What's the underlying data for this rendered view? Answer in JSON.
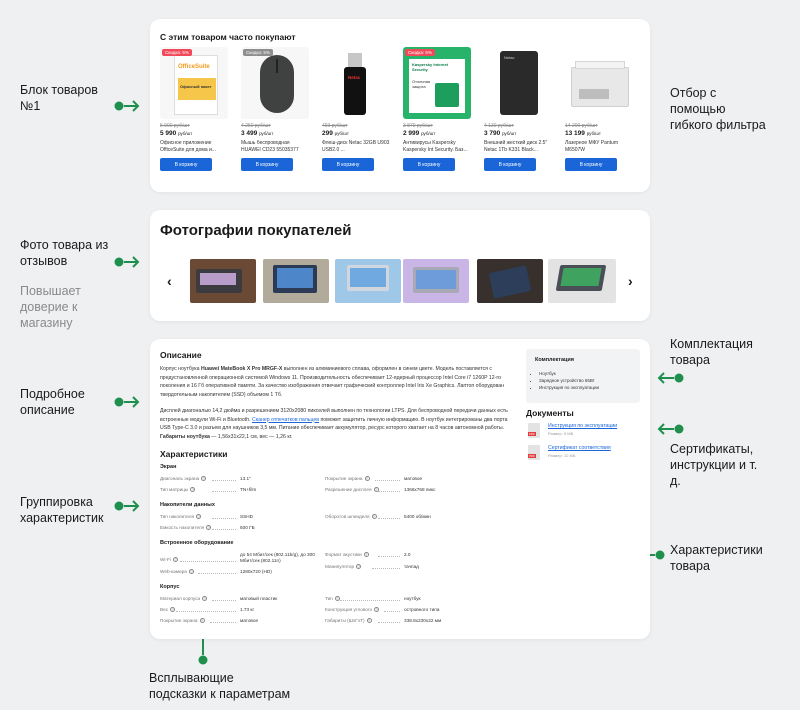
{
  "left_labels": {
    "block": "Блок товаров\n№1",
    "photos": "Фото товара из\nотзывов",
    "trust": "Повышает\nдоверие к\nмагазину",
    "desc": "Подробное\nописание",
    "group": "Группировка\nхарактеристик",
    "hints": "Всплывающие\nподсказки к параметрам"
  },
  "right_labels": {
    "filter": "Отбор с\nпомощью\nгибкого фильтра",
    "kit": "Комплектация\nтовара",
    "certs": "Сертификаты,\nинструкции и т.\nд.",
    "chars": "Характеристики\nтовара"
  },
  "related": {
    "title": "С этим товаром часто покупают",
    "products": [
      {
        "discount": "Скидка: 5%",
        "discount_style": "red",
        "old": "5 990 руб/шт",
        "price": "5 990",
        "unit": "руб/шт",
        "name": "Офисное приложение OfficeSuite для дома и...",
        "button": "В корзину"
      },
      {
        "discount": "Скидка: 5%",
        "discount_style": "grey",
        "old": "4 250 руб/шт",
        "price": "3 499",
        "unit": "руб/шт",
        "name": "Мышь беспроводная HUAWEI CD23 55035377",
        "button": "В корзину"
      },
      {
        "discount": "",
        "discount_style": "",
        "old": "469 руб/шт",
        "price": "299",
        "unit": "руб/шт",
        "name": "Флеш-диск Netac 32GB U903 USB2.0 ...",
        "button": "В корзину"
      },
      {
        "discount": "Скидка: 5%",
        "discount_style": "red",
        "old": "3 870 руб/шт",
        "price": "2 999",
        "unit": "руб/шт",
        "name": "Антивирусы Kaspersky Kaspersky Int Security. Баз...",
        "button": "В корзину"
      },
      {
        "discount": "",
        "discount_style": "",
        "old": "4 130 руб/шт",
        "price": "3 790",
        "unit": "руб/шт",
        "name": "Внешний жесткий диск 2.5\" Netac 1Tb K331 Black...",
        "button": "В корзину"
      },
      {
        "discount": "",
        "discount_style": "",
        "old": "14 200 руб/шт",
        "price": "13 199",
        "unit": "руб/шт",
        "name": "Лазерное МФУ Pantum M6507W",
        "button": "В корзину"
      }
    ],
    "product_art": {
      "officesuite": "OfficeSuite",
      "office_pack": "Офисный пакет",
      "kaspersky": "Kaspersky Internet Security",
      "kasp_box": "Отличная защита",
      "netac": "Netac"
    }
  },
  "photos": {
    "title": "Фотографии покупателей",
    "prev": "‹",
    "next": "›"
  },
  "description": {
    "title": "Описание",
    "p1_a": "Корпус ноутбука ",
    "p1_b": "Huawei MateBook X Pro MRGF-X",
    "p1_c": " выполнен из алюминиевого сплава, оформлен в синем цвете. Модель поставляется с предустановленной операционной системой Windows 11. Производительность обеспечивает 12-ядерный процессор Intel Core i7 1260P 12-го поколения и 16 Гб оперативной памяти. За качество изображения отвечает графический контроллер Intel Iris Xe Graphics. Лаптоп оборудован твердотельным накопителем (SSD) объемом 1 Тб.",
    "p2_a": "Дисплей диагональю 14,2 дюйма и разрешением 3120х2080 пикселей выполнен по технологии LTPS. Для беспроводной передачи данных есть встроенные модули Wi-Fi и Bluetooth. ",
    "p2_link": "Сканер отпечатков пальцев",
    "p2_b": " поможет защитить личную информацию. В ноутбук интегрированы два порта USB Type-C 3.0 и разъем для наушников 3,5 мм.  Питание обеспечивает аккумулятор, ресурс которого хватает на 8 часов автономной работы. ",
    "p2_bold": "Габариты ноутбука",
    "p2_c": " — 1,56х31х22,1 см, вес — 1,26 кг."
  },
  "kit": {
    "title": "Комплектация",
    "items": [
      "Ноутбук",
      "Зарядное устройство 65Вт",
      "Инструкция по эксплуатации"
    ]
  },
  "documents": {
    "title": "Документы",
    "items": [
      {
        "label": "Инструкция по эксплуатации",
        "size": "Размер: 5 МБ",
        "tag": "PDF"
      },
      {
        "label": "Сертификат соответствия",
        "size": "Размер: 12 МБ",
        "tag": "PDF"
      }
    ]
  },
  "specs": {
    "title": "Характеристики",
    "groups": [
      {
        "name": "Экран",
        "rows": [
          {
            "k": "Диагональ экрана",
            "v": "13.1\""
          },
          {
            "k": "Тип матрицы",
            "v": "TN+film"
          },
          {
            "k": "Покрытие экрана",
            "v": "матовое"
          },
          {
            "k": "Разрешение дисплея",
            "v": "1366x768 пикс"
          }
        ]
      },
      {
        "name": "Накопители данных",
        "rows": [
          {
            "k": "Тип накопителя",
            "v": "SSHD"
          },
          {
            "k": "Емкость накопителя",
            "v": "500 ГБ"
          },
          {
            "k": "Оборотов шпинделя",
            "v": "5400 об/мин"
          }
        ]
      },
      {
        "name": "Встроенное оборудование",
        "rows": [
          {
            "k": "Wi-Fi",
            "v": "до 54 Мбит/сек (802.11b/g), до 300 Мбит/сек (802.11n)"
          },
          {
            "k": "Web-камера",
            "v": "1280x720 (HD)"
          },
          {
            "k": "Формат акустики",
            "v": "2.0"
          },
          {
            "k": "Манипулятор",
            "v": "тачпад"
          }
        ]
      },
      {
        "name": "Корпус",
        "rows": [
          {
            "k": "Материал корпуса",
            "v": "матовый пластик"
          },
          {
            "k": "Вес",
            "v": "1.73 кг"
          },
          {
            "k": "Покрытие экрана",
            "v": "матовое"
          },
          {
            "k": "Тип",
            "v": "ноутбук"
          },
          {
            "k": "Конструкция углового",
            "v": "островного типа"
          },
          {
            "k": "Габариты (ШхГхТ)",
            "v": "338.8x230x22 мм"
          }
        ]
      }
    ]
  },
  "colors": {
    "accent": "#1f8f4d",
    "button": "#1a66d8",
    "discount": "#f04a5a"
  }
}
